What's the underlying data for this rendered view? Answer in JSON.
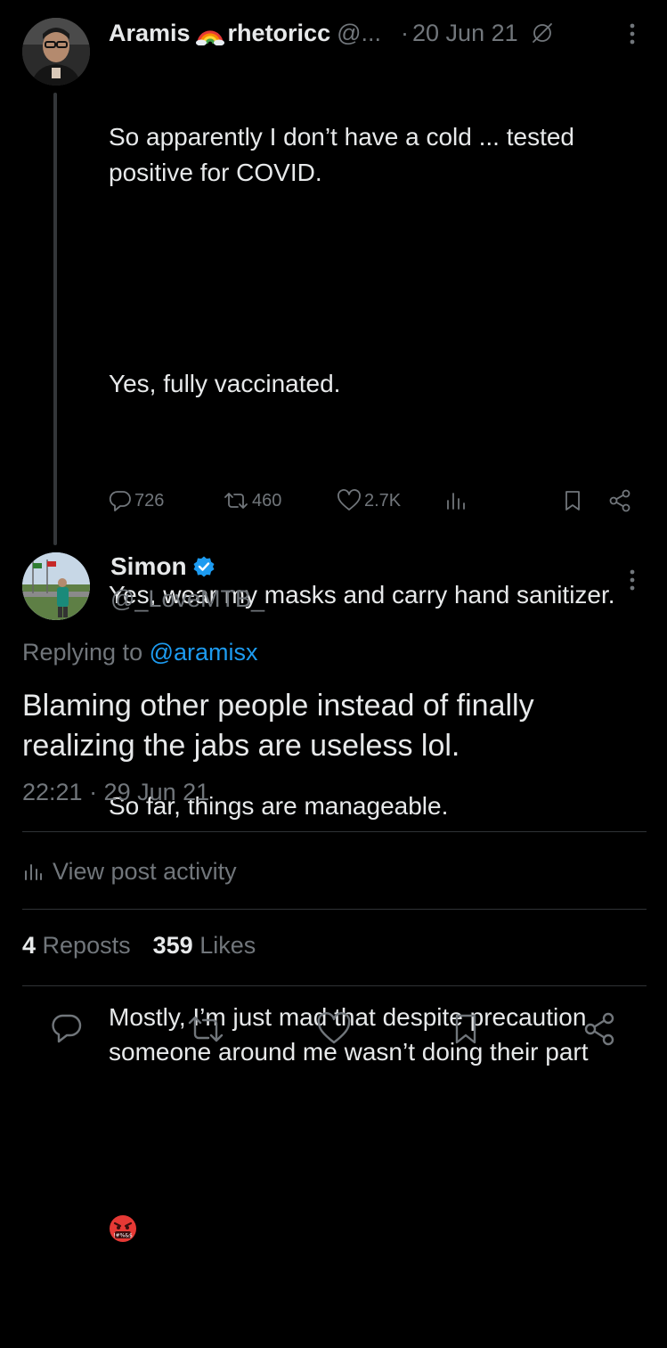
{
  "parent_tweet": {
    "display_name": "Aramis",
    "name_emoji": "rainbow",
    "handle_partial": "rhetoricc",
    "handle_rest": "@...",
    "separator": "·",
    "date": "20 Jun 21",
    "body_lines": [
      "So apparently I don’t have a cold ... tested positive for COVID.",
      "",
      "Yes, fully vaccinated.",
      "",
      "Yes, wear my masks and carry hand sanitizer.",
      "",
      "So far, things are manageable.",
      "",
      "Mostly, I’m just mad that despite precaution someone around me wasn’t doing their part"
    ],
    "body_emoji": "face-with-symbols-on-mouth",
    "actions": {
      "replies": "726",
      "reposts": "460",
      "likes": "2.7K"
    }
  },
  "reply_tweet": {
    "display_name": "Simon",
    "verified": true,
    "handle": "@_LoveMTB_",
    "replying_prefix": "Replying to",
    "replying_to": "@aramisx",
    "body": "Blaming other people instead of finally realizing the jabs are useless lol.",
    "timestamp": "22:21 · 29 Jun 21",
    "activity_label": "View post activity",
    "reposts_count": "4",
    "reposts_label": "Reposts",
    "likes_count": "359",
    "likes_label": "Likes"
  },
  "icons": {
    "reply": "reply-icon",
    "repost": "repost-icon",
    "like": "heart-icon",
    "views": "bar-chart-icon",
    "bookmark": "bookmark-icon",
    "share": "share-icon",
    "more": "more-vertical-icon",
    "verified": "verified-badge-icon",
    "grok": "grok-icon"
  },
  "colors": {
    "background": "#000000",
    "text": "#e7e9ea",
    "secondary": "#71767b",
    "link": "#1d9bf0",
    "verified": "#1d9bf0",
    "divider": "#2f3336"
  }
}
